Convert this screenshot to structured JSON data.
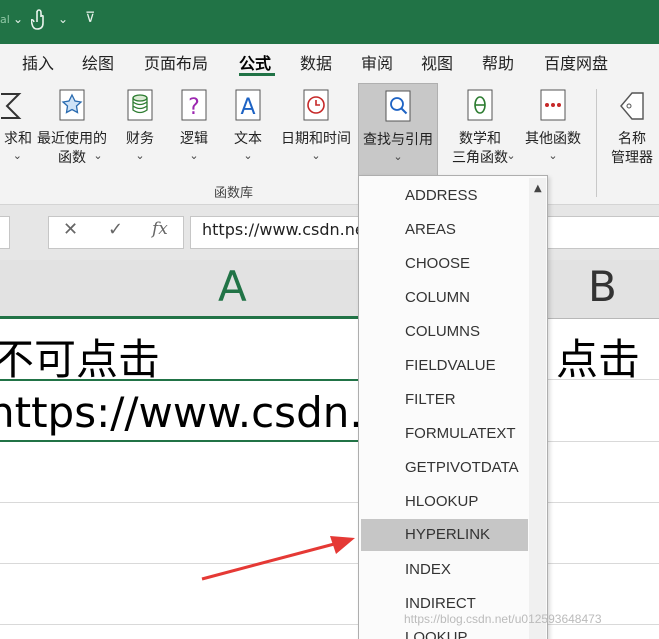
{
  "titlebar": {
    "autosave_fragment": "al",
    "chevron": "⌄",
    "qat_glyph": "⊽"
  },
  "menu": {
    "tabs": [
      "插入",
      "绘图",
      "页面布局",
      "公式",
      "数据",
      "审阅",
      "视图",
      "帮助",
      "百度网盘"
    ],
    "active": "公式"
  },
  "ribbon": {
    "buttons": [
      {
        "label": "求和",
        "chevron": "⌄",
        "icon": "autosum-icon"
      },
      {
        "label": "最近使用的\n函数",
        "chevron": "⌄",
        "icon": "star-icon"
      },
      {
        "label": "财务",
        "chevron": "⌄",
        "icon": "coins-icon"
      },
      {
        "label": "逻辑",
        "chevron": "⌄",
        "icon": "question-icon"
      },
      {
        "label": "文本",
        "chevron": "⌄",
        "icon": "text-a-icon"
      },
      {
        "label": "日期和时间",
        "chevron": "⌄",
        "icon": "clock-icon"
      },
      {
        "label": "查找与引用",
        "chevron": "⌄",
        "icon": "magnifier-icon"
      },
      {
        "label": "数学和\n三角函数",
        "chevron": "⌄",
        "icon": "theta-icon"
      },
      {
        "label": "其他函数",
        "chevron": "⌄",
        "icon": "more-icon"
      },
      {
        "label": "名称\n管理器",
        "chevron": "",
        "icon": "tag-icon"
      }
    ],
    "group_label": "函数库",
    "accent": "#217346"
  },
  "formula_bar": {
    "cancel": "✕",
    "enter": "✓",
    "fx": "fx",
    "value": "https://www.csdn.ne"
  },
  "grid": {
    "column_headers": [
      "A",
      "B"
    ],
    "cells": {
      "a1": "不可点击",
      "b1": "点击",
      "a2": "https://www.csdn."
    }
  },
  "dropdown": {
    "items": [
      "ADDRESS",
      "AREAS",
      "CHOOSE",
      "COLUMN",
      "COLUMNS",
      "FIELDVALUE",
      "FILTER",
      "FORMULATEXT",
      "GETPIVOTDATA",
      "HLOOKUP",
      "HYPERLINK",
      "INDEX",
      "INDIRECT",
      "LOOKUP"
    ],
    "highlighted": "HYPERLINK",
    "scroll_up": "▲"
  },
  "watermark": "https://blog.csdn.net/u012593648473",
  "annotation": {
    "color": "#e53935"
  }
}
